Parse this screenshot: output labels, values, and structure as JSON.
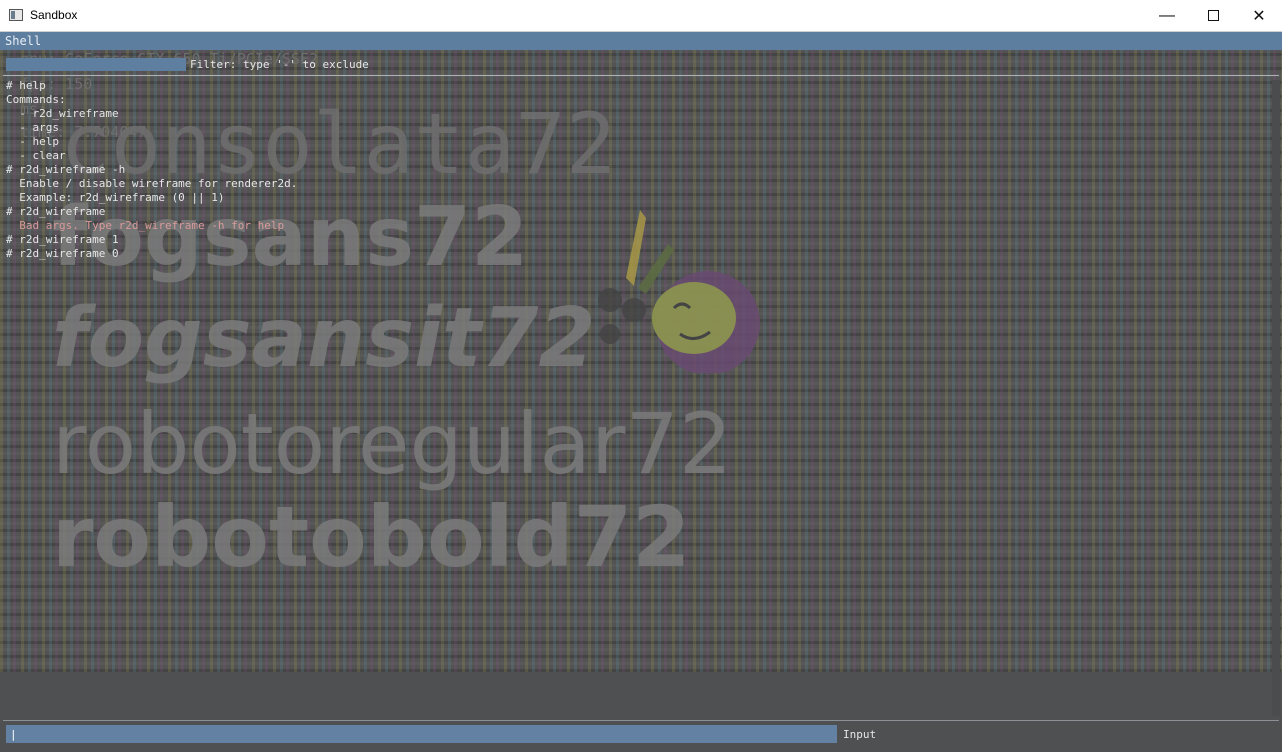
{
  "window": {
    "title": "Sandbox",
    "minimize_glyph": "—",
    "close_glyph": "✕"
  },
  "menubar": {
    "shell_label": "Shell"
  },
  "scene": {
    "ghost_lines": [
      "gpu: GeForce GTX 650 Ti/PCIe/SSE2",
      "fps: 150",
      "ms: ",
      "time: 7.704047"
    ],
    "font_samples": [
      "consolata72",
      "fogsans72",
      "fogsansit72",
      "robotoregular72",
      "robotobold72"
    ]
  },
  "shell": {
    "filter_label": "Filter: type '-' to exclude",
    "lines": [
      {
        "text": "# help",
        "type": "cmd"
      },
      {
        "text": "Commands:",
        "type": "out"
      },
      {
        "text": "  - r2d_wireframe",
        "type": "out"
      },
      {
        "text": "  - args",
        "type": "out"
      },
      {
        "text": "  - help",
        "type": "out"
      },
      {
        "text": "  - clear",
        "type": "out"
      },
      {
        "text": "# r2d_wireframe -h",
        "type": "cmd"
      },
      {
        "text": "  Enable / disable wireframe for renderer2d.",
        "type": "out"
      },
      {
        "text": "  Example: r2d_wireframe (0 || 1)",
        "type": "out"
      },
      {
        "text": "# r2d_wireframe",
        "type": "cmd"
      },
      {
        "text": "  Bad args. Type r2d_wireframe -h for help",
        "type": "err"
      },
      {
        "text": "# r2d_wireframe 1",
        "type": "cmd"
      },
      {
        "text": "# r2d_wireframe 0",
        "type": "cmd"
      }
    ],
    "input_value": "|",
    "input_label": "Input"
  },
  "colors": {
    "menubar": "#5e7e9f",
    "input_field": "#6281a3",
    "error_text": "#d99a9a",
    "console_text": "#e6e6e6"
  }
}
